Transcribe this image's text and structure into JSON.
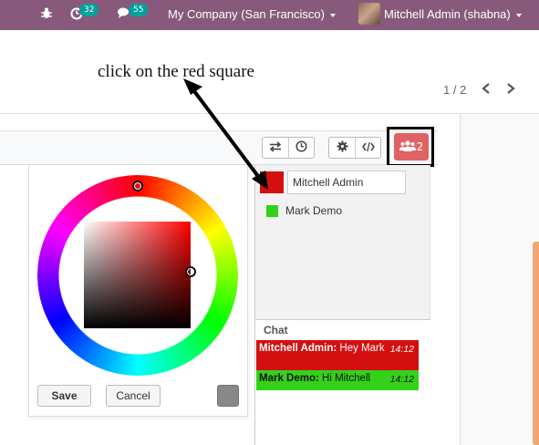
{
  "topbar": {
    "bug_icon": "bug-icon",
    "activity_badge": "32",
    "messages_badge": "55",
    "company": "My Company (San Francisco)",
    "user": "Mitchell Admin (shabna)"
  },
  "annotation": {
    "text": "click on the red square"
  },
  "pager": {
    "value": "1 / 2"
  },
  "toolbar": {
    "swap_icon": "swap-icon",
    "history_icon": "clock-icon",
    "settings_icon": "gear-icon",
    "code_icon": "code-icon",
    "users_count": "2"
  },
  "color_picker": {
    "save_label": "Save",
    "cancel_label": "Cancel"
  },
  "collaboration": {
    "users": [
      {
        "name": "Mitchell Admin",
        "color": "#d40f0f"
      },
      {
        "name": "Mark Demo",
        "color": "#33d219"
      }
    ],
    "chat_title": "Chat",
    "messages": [
      {
        "author": "Mitchell Admin:",
        "text": "Hey Mark",
        "time": "14:12"
      },
      {
        "author": "Mark Demo:",
        "text": "Hi Mitchell",
        "time": "14:12"
      }
    ]
  },
  "colors": {
    "navbar": "#875a7b",
    "badge": "#00a09d",
    "user1": "#d40f0f",
    "user2": "#33d219",
    "users_button": "#e06363"
  }
}
